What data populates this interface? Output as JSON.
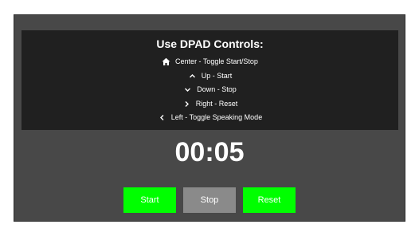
{
  "instructions": {
    "title": "Use DPAD Controls:",
    "lines": [
      {
        "icon": "home-icon",
        "text": "Center - Toggle Start/Stop"
      },
      {
        "icon": "chevron-up-icon",
        "text": "Up - Start"
      },
      {
        "icon": "chevron-down-icon",
        "text": "Down - Stop"
      },
      {
        "icon": "chevron-right-icon",
        "text": "Right - Reset"
      },
      {
        "icon": "chevron-left-icon",
        "text": "Left - Toggle Speaking Mode"
      }
    ]
  },
  "timer": {
    "display": "00:05"
  },
  "controls": {
    "start_label": "Start",
    "stop_label": "Stop",
    "reset_label": "Reset"
  },
  "colors": {
    "background": "#484848",
    "panel": "#202020",
    "start_button": "#00ff00",
    "stop_button": "#8a8a8a",
    "reset_button": "#00ff00",
    "text": "#ffffff"
  }
}
